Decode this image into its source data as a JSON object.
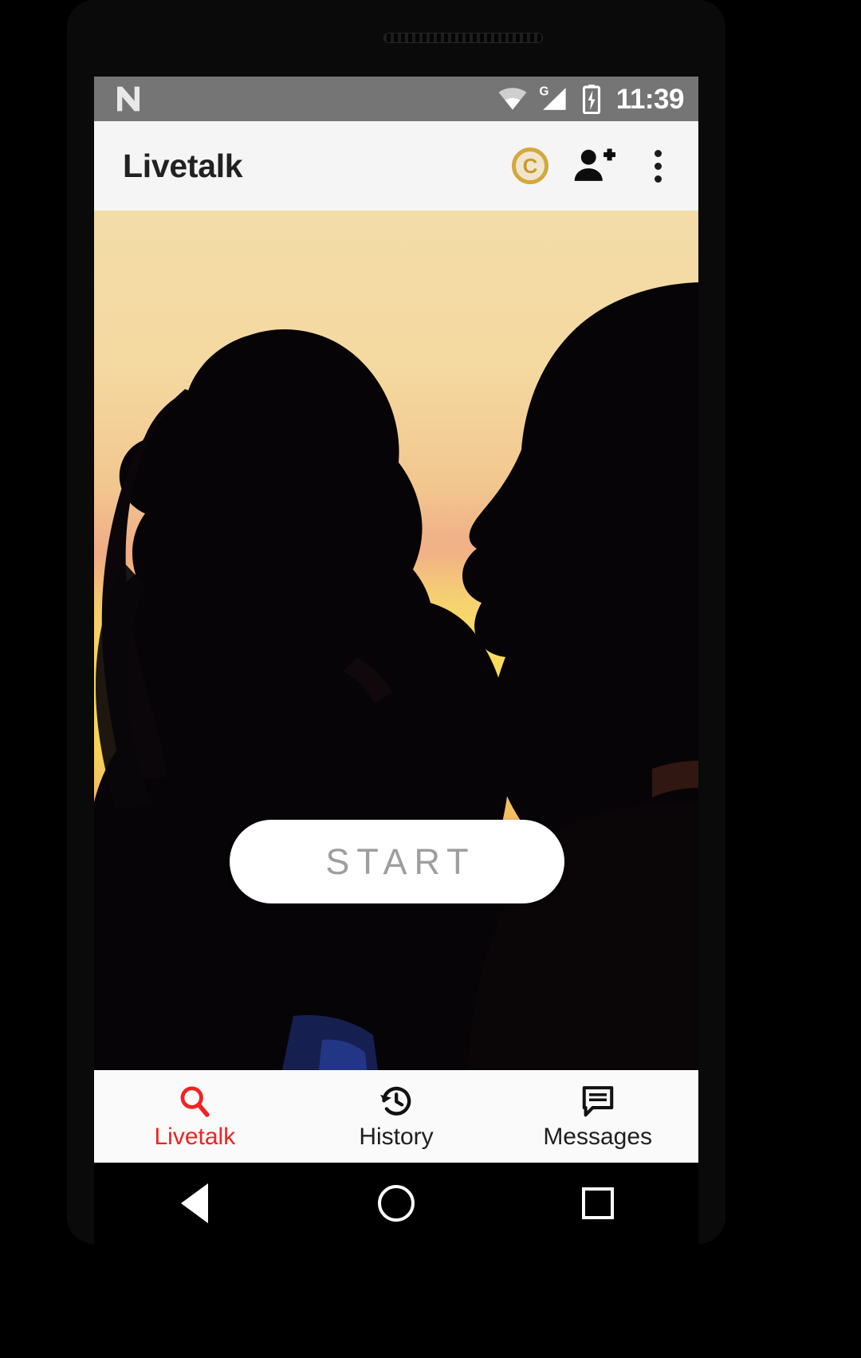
{
  "device": {
    "speaker_grille": "speaker-grille"
  },
  "status_bar": {
    "os_logo": "android-nougat-n-logo",
    "wifi_icon": "wifi-icon",
    "network_label": "G",
    "signal_icon": "cellular-signal-icon",
    "battery_icon": "battery-charging-icon",
    "time": "11:39",
    "background_color": "#757575"
  },
  "app_bar": {
    "title": "Livetalk",
    "background_color": "#f5f5f5",
    "actions": [
      {
        "name": "coins-button",
        "icon": "coin-icon",
        "label": "C"
      },
      {
        "name": "add-friend-button",
        "icon": "person-add-icon"
      },
      {
        "name": "overflow-menu-button",
        "icon": "more-vert-icon"
      }
    ]
  },
  "main": {
    "hero_image": {
      "name": "couple-silhouette-sunset-photo",
      "description": "Silhouette of a couple touching foreheads at sunset",
      "sky_top_color": "#f2d9a0",
      "sky_glow_color": "#f6d44e",
      "sky_pink_color": "#f0a383",
      "sky_bottom_color": "#b8b3c4",
      "silhouette_color": "#050305"
    },
    "start_button": {
      "label": "START",
      "text_color": "#9e9e9e",
      "background_color": "#ffffff"
    }
  },
  "bottom_nav": {
    "active_color": "#f22222",
    "inactive_color": "#1f1f1f",
    "items": [
      {
        "name": "nav-livetalk",
        "label": "Livetalk",
        "icon": "search-icon",
        "active": true
      },
      {
        "name": "nav-history",
        "label": "History",
        "icon": "history-icon",
        "active": false
      },
      {
        "name": "nav-messages",
        "label": "Messages",
        "icon": "chat-message-icon",
        "active": false
      }
    ]
  },
  "system_nav": {
    "items": [
      {
        "name": "system-back-button",
        "icon": "back-triangle-icon"
      },
      {
        "name": "system-home-button",
        "icon": "home-circle-icon"
      },
      {
        "name": "system-recents-button",
        "icon": "recents-square-icon"
      }
    ]
  }
}
